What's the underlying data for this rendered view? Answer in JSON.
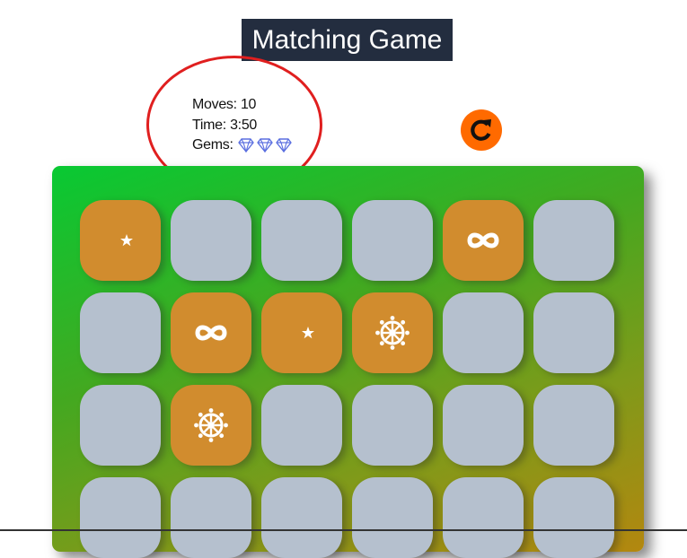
{
  "game": {
    "title": "Matching Game",
    "moves_label": "Moves:",
    "moves": "10",
    "time_label": "Time:",
    "time": "3:50",
    "gems_label": "Gems:",
    "gems_count": 3,
    "gem_icon": "diamond-icon",
    "restart_icon": "restart-icon"
  },
  "colors": {
    "title_bg": "#232d3f",
    "card_back": "#b5c0ce",
    "card_open": "#d18c2e",
    "restart": "#ff6a00",
    "annotation": "#e01f1f",
    "gem": "#5b6fe0"
  },
  "board": {
    "columns": 6,
    "cards": [
      {
        "state": "open",
        "icon": "star-and-crescent-icon"
      },
      {
        "state": "closed",
        "icon": ""
      },
      {
        "state": "closed",
        "icon": ""
      },
      {
        "state": "closed",
        "icon": ""
      },
      {
        "state": "open",
        "icon": "infinity-icon"
      },
      {
        "state": "closed",
        "icon": ""
      },
      {
        "state": "closed",
        "icon": ""
      },
      {
        "state": "open",
        "icon": "infinity-icon"
      },
      {
        "state": "open",
        "icon": "star-and-crescent-icon"
      },
      {
        "state": "open",
        "icon": "dharmachakra-icon"
      },
      {
        "state": "closed",
        "icon": ""
      },
      {
        "state": "closed",
        "icon": ""
      },
      {
        "state": "closed",
        "icon": ""
      },
      {
        "state": "open",
        "icon": "dharmachakra-icon"
      },
      {
        "state": "closed",
        "icon": ""
      },
      {
        "state": "closed",
        "icon": ""
      },
      {
        "state": "closed",
        "icon": ""
      },
      {
        "state": "closed",
        "icon": ""
      },
      {
        "state": "closed",
        "icon": ""
      },
      {
        "state": "closed",
        "icon": ""
      },
      {
        "state": "closed",
        "icon": ""
      },
      {
        "state": "closed",
        "icon": ""
      },
      {
        "state": "closed",
        "icon": ""
      },
      {
        "state": "closed",
        "icon": ""
      }
    ]
  }
}
